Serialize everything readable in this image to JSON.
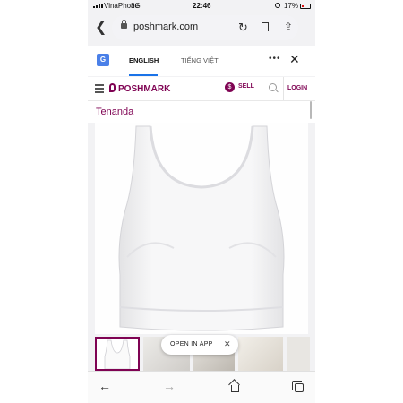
{
  "status_bar": {
    "carrier": "VinaPhone",
    "network": "3G",
    "time": "22:46",
    "battery": "17%",
    "icons": [
      "signal-icon",
      "alarm-icon",
      "battery-icon"
    ]
  },
  "browser": {
    "url": "poshmark.com",
    "icons": [
      "back-icon",
      "lock-icon",
      "reload-icon",
      "bookmark-icon",
      "share-icon"
    ]
  },
  "translate_bar": {
    "tab_english": "ENGLISH",
    "tab_vietnamese": "TIẾNG VIỆT",
    "icons": [
      "google-translate-icon",
      "more-icon",
      "close-icon"
    ]
  },
  "poshmark_header": {
    "logo_text": "POSHMARK",
    "sell_label": "SELL",
    "login_label": "LOGIN",
    "brand_color": "#7f0353",
    "icons": [
      "menu-icon",
      "poshmark-logo-icon",
      "sell-icon",
      "search-icon"
    ]
  },
  "listing": {
    "title": "Tenanda",
    "image_subject": "white crop tank top",
    "thumbnail_count": 5,
    "selected_thumbnail": 1
  },
  "open_in_app": {
    "label": "OPEN IN APP",
    "close_symbol": "✕"
  },
  "bottom_toolbar": {
    "icons": [
      "nav-back-icon",
      "nav-forward-icon",
      "home-icon",
      "tabs-icon"
    ]
  }
}
